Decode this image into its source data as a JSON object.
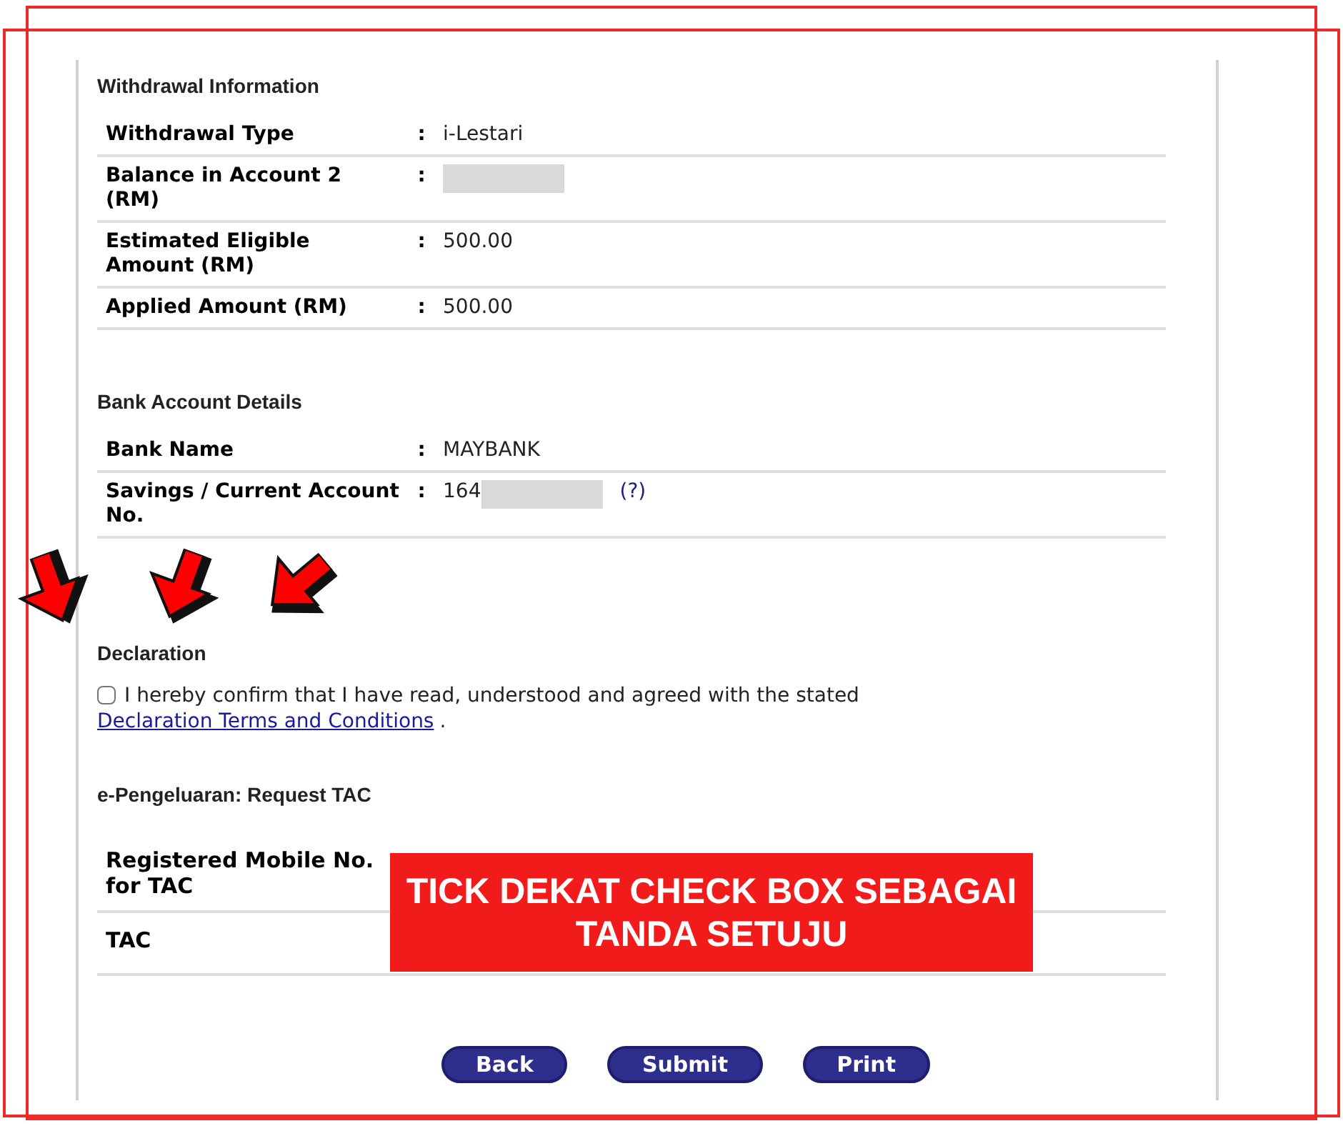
{
  "sections": [
    {
      "title": "Withdrawal Information",
      "rows": [
        {
          "label": "Withdrawal Type",
          "colon": ":",
          "value": "i-Lestari"
        },
        {
          "label": "Balance in Account 2 (RM)",
          "colon": ":",
          "redacted": true
        },
        {
          "label": "Estimated Eligible Amount (RM)",
          "colon": ":",
          "value": "500.00"
        },
        {
          "label": "Applied Amount (RM)",
          "colon": ":",
          "value": "500.00"
        }
      ]
    },
    {
      "title": "Bank Account Details",
      "rows": [
        {
          "label": "Bank Name",
          "colon": ":",
          "value": "MAYBANK"
        },
        {
          "label": "Savings / Current Account No.",
          "colon": ":",
          "value": "164",
          "redacted": true,
          "help": "(?)"
        }
      ]
    }
  ],
  "declaration": {
    "title": "Declaration",
    "checked": false,
    "text": "I hereby confirm that I have read, understood and agreed with the stated",
    "link": "Declaration Terms and Conditions",
    "end": "."
  },
  "tac": {
    "title": "e-Pengeluaran: Request TAC",
    "rows": [
      {
        "label": "Registered Mobile No. for TAC"
      },
      {
        "label": "TAC"
      }
    ]
  },
  "banner": {
    "line1": "TICK DEKAT CHECK BOX SEBAGAI",
    "line2": "TANDA SETUJU"
  },
  "buttons": [
    "Back",
    "Submit",
    "Print"
  ]
}
